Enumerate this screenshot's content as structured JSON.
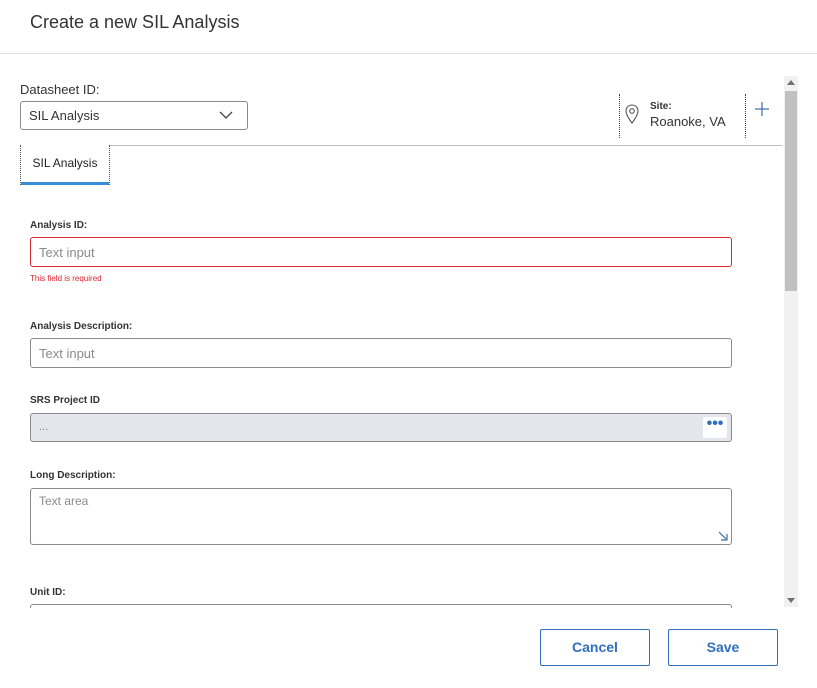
{
  "dialog": {
    "title": "Create a new SIL Analysis"
  },
  "datasheet": {
    "label": "Datasheet ID:",
    "selected": "SIL Analysis"
  },
  "site": {
    "label": "Site:",
    "value": "Roanoke, VA"
  },
  "tabs": [
    {
      "label": "SIL Analysis",
      "active": true
    }
  ],
  "fields": {
    "analysis_id": {
      "label": "Analysis ID:",
      "placeholder": "Text input",
      "error": "This field is required"
    },
    "analysis_description": {
      "label": "Analysis Description:",
      "placeholder": "Text input"
    },
    "srs_project_id": {
      "label": "SRS Project ID",
      "value": "...",
      "button_label": "•••"
    },
    "long_description": {
      "label": "Long Description:",
      "placeholder": "Text area"
    },
    "unit_id": {
      "label": "Unit ID:"
    }
  },
  "footer": {
    "cancel_label": "Cancel",
    "save_label": "Save"
  },
  "colors": {
    "accent": "#2f6fbd",
    "error": "#d9272e",
    "tab_indicator": "#3a8dd8",
    "disabled_bg": "#e3e6ec"
  },
  "icons": {
    "site": "map-pin-icon",
    "add": "plus-icon",
    "dropdown": "chevron-down-icon",
    "resize": "resize-handle-icon"
  }
}
